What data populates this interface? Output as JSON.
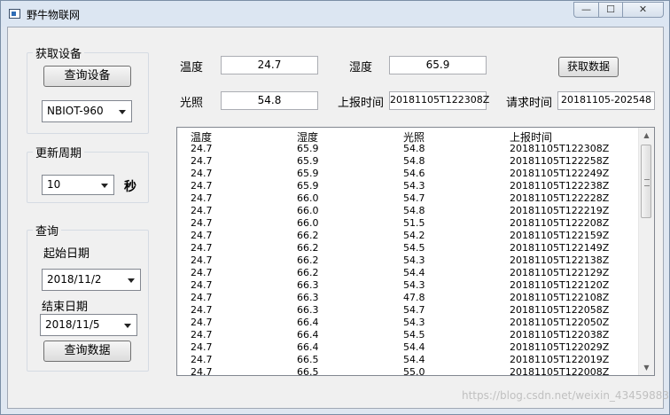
{
  "window": {
    "title": "野牛物联网",
    "minimize_glyph": "—",
    "maximize_glyph": "☐",
    "close_glyph": "✕"
  },
  "device_group": {
    "legend": "获取设备",
    "query_button": "查询设备",
    "device_select": "NBIOT-960"
  },
  "period_group": {
    "legend": "更新周期",
    "period_select": "10",
    "unit": "秒"
  },
  "query_group": {
    "legend": "查询",
    "start_label": "起始日期",
    "start_date": "2018/11/2",
    "end_label": "结束日期",
    "end_date": "2018/11/5",
    "query_button": "查询数据"
  },
  "readings": {
    "temp_label": "温度",
    "temp_value": "24.7",
    "humidity_label": "湿度",
    "humidity_value": "65.9",
    "light_label": "光照",
    "light_value": "54.8",
    "report_time_label": "上报时间",
    "report_time_value": "20181105T122308Z",
    "request_time_label": "请求时间",
    "request_time_value": "20181105-202548",
    "fetch_button": "获取数据"
  },
  "table": {
    "headers": [
      "温度",
      "湿度",
      "光照",
      "上报时间"
    ],
    "rows": [
      [
        "24.7",
        "65.9",
        "54.8",
        "20181105T122308Z"
      ],
      [
        "24.7",
        "65.9",
        "54.8",
        "20181105T122258Z"
      ],
      [
        "24.7",
        "65.9",
        "54.6",
        "20181105T122249Z"
      ],
      [
        "24.7",
        "65.9",
        "54.3",
        "20181105T122238Z"
      ],
      [
        "24.7",
        "66.0",
        "54.7",
        "20181105T122228Z"
      ],
      [
        "24.7",
        "66.0",
        "54.8",
        "20181105T122219Z"
      ],
      [
        "24.7",
        "66.0",
        "51.5",
        "20181105T122208Z"
      ],
      [
        "24.7",
        "66.2",
        "54.2",
        "20181105T122159Z"
      ],
      [
        "24.7",
        "66.2",
        "54.5",
        "20181105T122149Z"
      ],
      [
        "24.7",
        "66.2",
        "54.3",
        "20181105T122138Z"
      ],
      [
        "24.7",
        "66.2",
        "54.4",
        "20181105T122129Z"
      ],
      [
        "24.7",
        "66.3",
        "54.3",
        "20181105T122120Z"
      ],
      [
        "24.7",
        "66.3",
        "47.8",
        "20181105T122108Z"
      ],
      [
        "24.7",
        "66.3",
        "54.7",
        "20181105T122058Z"
      ],
      [
        "24.7",
        "66.4",
        "54.3",
        "20181105T122050Z"
      ],
      [
        "24.7",
        "66.4",
        "54.5",
        "20181105T122038Z"
      ],
      [
        "24.7",
        "66.4",
        "54.4",
        "20181105T122029Z"
      ],
      [
        "24.7",
        "66.5",
        "54.4",
        "20181105T122019Z"
      ],
      [
        "24.7",
        "66.5",
        "55.0",
        "20181105T122008Z"
      ]
    ]
  },
  "watermark": "https://blog.csdn.net/weixin_43459883"
}
